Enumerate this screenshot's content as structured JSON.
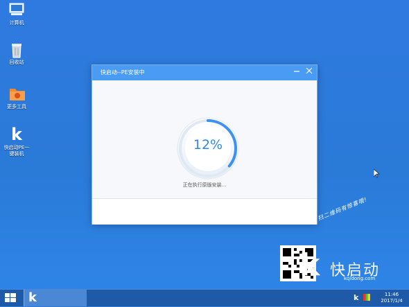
{
  "desktop": {
    "icons": [
      {
        "label": "计算机"
      },
      {
        "label": "回收站"
      },
      {
        "label": "更多工具"
      },
      {
        "label": "快启动PE一\n键装机"
      }
    ]
  },
  "dialog": {
    "title": "快启动--PE安装中",
    "progress": 0.12,
    "progress_text": "12%",
    "status_text": "正在执行原版安装...",
    "colors": {
      "titlebar": "#4a9bf3",
      "accent": "#2f86e8"
    }
  },
  "promo": {
    "slogan": "扫二维码有惊喜哦!",
    "brand": "快启动",
    "url": "kqidong.com"
  },
  "taskbar": {
    "task_label": "k",
    "tray_label": "k",
    "time": "11:46",
    "date": "2017/1/4"
  }
}
